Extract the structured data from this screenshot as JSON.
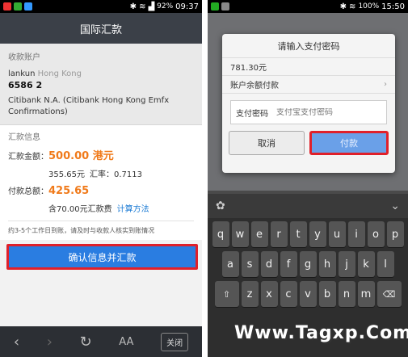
{
  "left": {
    "status": {
      "battery": "92%",
      "time": "09:37"
    },
    "title": "国际汇款",
    "payee_label": "收款账户",
    "payee_name": "lankun",
    "payee_region": "Hong Kong",
    "payee_account": "6586 2",
    "bank_name": "Citibank N.A. (Citibank Hong Kong Emfx Confirmations)",
    "info_label": "汇款信息",
    "amount_label": "汇款金额：",
    "amount_value": "500.00 港元",
    "converted": "355.65元",
    "rate_text": "汇率：0.7113",
    "total_label": "付款总额：",
    "total_value": "425.65",
    "fee_text": "含70.00元汇款费",
    "calc_link": "计算方法",
    "notice": "约3-5个工作日到账，请及时与收款人核实到账情况",
    "confirm_button": "确认信息并汇款",
    "nav": {
      "back": "‹",
      "forward": "›",
      "refresh": "↻",
      "font": "AA",
      "close": "关闭"
    }
  },
  "right": {
    "status": {
      "battery": "100%",
      "time": "15:50"
    },
    "dialog_title": "请输入支付密码",
    "amount": "781.30元",
    "pay_method": "账户余额付款",
    "password_label": "支付密码",
    "password_placeholder": "支付宝支付密码",
    "cancel_button": "取消",
    "pay_button": "付款",
    "keyboard_rows": [
      [
        "q",
        "w",
        "e",
        "r",
        "t",
        "y",
        "u",
        "i",
        "o",
        "p"
      ],
      [
        "a",
        "s",
        "d",
        "f",
        "g",
        "h",
        "j",
        "k",
        "l"
      ],
      [
        "⇧",
        "z",
        "x",
        "c",
        "v",
        "b",
        "n",
        "m",
        "⌫"
      ]
    ]
  },
  "watermark": "Www.Tagxp.Com"
}
